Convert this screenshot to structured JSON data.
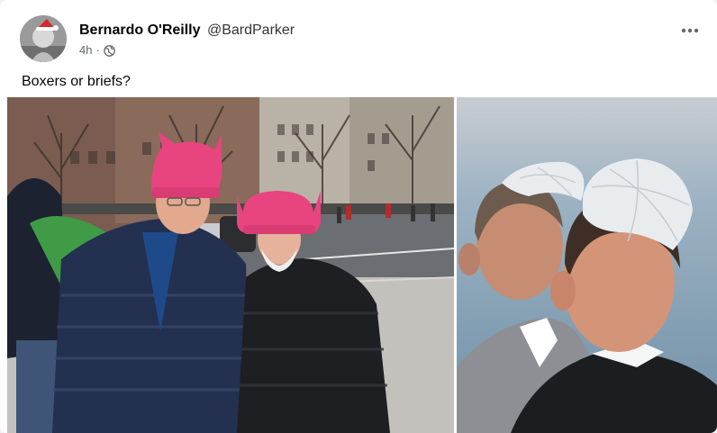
{
  "post": {
    "author_name": "Bernardo O'Reilly",
    "author_handle": "@BardParker",
    "timestamp": "4h",
    "separator": "·",
    "privacy_icon": "globe-icon",
    "more_icon": "more-options-icon",
    "text": "Boxers or briefs?"
  },
  "colors": {
    "hat_pink": "#e8447f",
    "kippah_white": "#e9ecef",
    "jacket_navy": "#23304f",
    "jacket_black": "#1e1f22",
    "sky_gray": "#c8cdd2",
    "backdrop_blue": "#7f9fb5"
  }
}
